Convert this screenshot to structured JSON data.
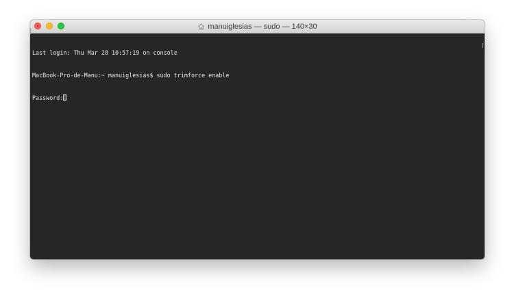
{
  "window": {
    "title": "manuiglesias — sudo — 140×30"
  },
  "terminal": {
    "lines": [
      "Last login: Thu Mar 28 10:57:19 on console",
      "MacBook-Pro-de-Manu:~ manuiglesias$ sudo trimforce enable",
      "Password:"
    ]
  },
  "icons": {
    "title": "home-icon",
    "traffic_lights": [
      "close-icon",
      "minimize-icon",
      "maximize-icon"
    ]
  },
  "colors": {
    "terminal_background": "#262626",
    "terminal_text": "#e8e8e8",
    "close": "#ff5f57",
    "minimize": "#febc2e",
    "maximize": "#28c840"
  }
}
